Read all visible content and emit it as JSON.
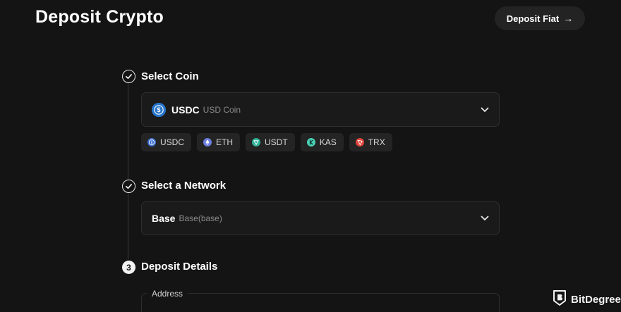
{
  "header": {
    "title": "Deposit Crypto",
    "deposit_fiat_label": "Deposit Fiat",
    "deposit_fiat_arrow": "→"
  },
  "steps": [
    {
      "label": "Select Coin",
      "state": "done"
    },
    {
      "label": "Select a Network",
      "state": "done"
    },
    {
      "label": "Deposit Details",
      "state": "current",
      "number": "3"
    }
  ],
  "coin_select": {
    "symbol": "USDC",
    "name": "USD Coin",
    "icon": "usdc-icon"
  },
  "quick_coins": [
    {
      "symbol": "USDC",
      "icon": "usdc-icon",
      "color": "#3b6fcf"
    },
    {
      "symbol": "ETH",
      "icon": "eth-icon",
      "color": "#6b7ee0"
    },
    {
      "symbol": "USDT",
      "icon": "usdt-icon",
      "color": "#2fb397"
    },
    {
      "symbol": "KAS",
      "icon": "kas-icon",
      "color": "#49d3b5"
    },
    {
      "symbol": "TRX",
      "icon": "trx-icon",
      "color": "#e0453c"
    }
  ],
  "network_select": {
    "name": "Base",
    "detail": "Base(base)"
  },
  "deposit_details": {
    "address_label": "Address"
  },
  "watermark": {
    "text": "BitDegree"
  },
  "colors": {
    "background": "#141414",
    "panel": "#1a1a1a",
    "usdc_blue": "#2775ca"
  }
}
